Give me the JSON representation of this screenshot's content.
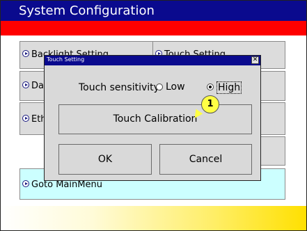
{
  "app": {
    "title": "System Configuration"
  },
  "menu": {
    "items": [
      {
        "label": "Backlight Setting"
      },
      {
        "label": "Touch Setting"
      },
      {
        "label": "Date"
      },
      {
        "label": "Ethernet"
      }
    ],
    "goto_label": "Goto MainMenu"
  },
  "dialog": {
    "title": "Touch Setting",
    "close_glyph": "✕",
    "sensitivity_label": "Touch sensitivity:",
    "options": [
      {
        "label": "Low",
        "selected": false
      },
      {
        "label": "High",
        "selected": true
      }
    ],
    "calibration_label": "Touch Calibration",
    "ok_label": "OK",
    "cancel_label": "Cancel"
  },
  "callout": {
    "number": "1"
  },
  "colors": {
    "title_bar": "#0a0a8e",
    "red_band": "#ff0000",
    "goto_bg": "#ccffff",
    "callout": "#ffff44"
  }
}
